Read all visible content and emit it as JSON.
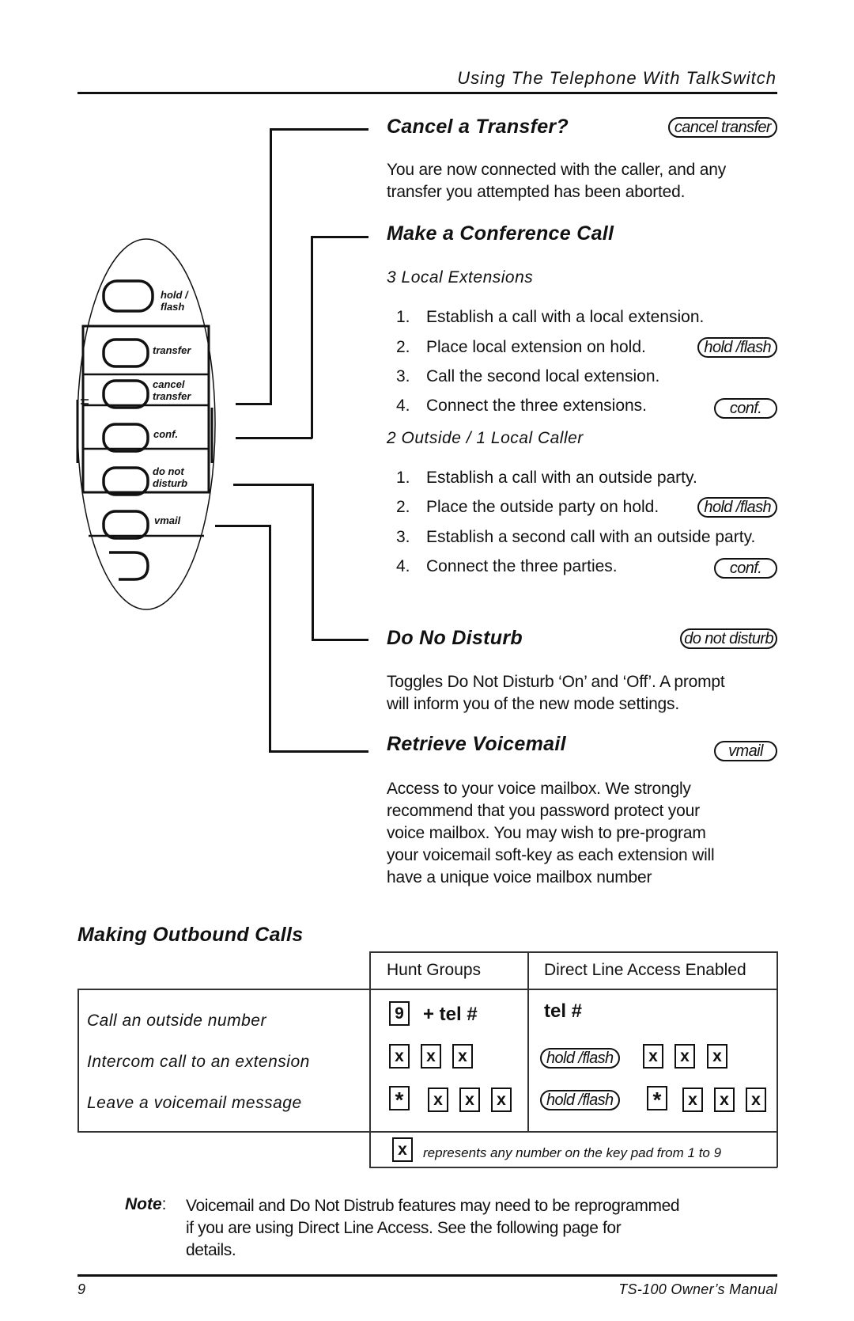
{
  "header": {
    "running_title": "Using The Telephone With TalkSwitch"
  },
  "phone_keys": [
    {
      "label_lines": [
        "hold /",
        "flash"
      ]
    },
    {
      "label_lines": [
        "transfer"
      ]
    },
    {
      "label_lines": [
        "cancel",
        "transfer"
      ]
    },
    {
      "label_lines": [
        "conf."
      ]
    },
    {
      "label_lines": [
        "do not",
        "disturb"
      ]
    },
    {
      "label_lines": [
        "vmail"
      ]
    }
  ],
  "sections": {
    "cancel_transfer": {
      "title": "Cancel a Transfer?",
      "key": "cancel transfer",
      "body": [
        "You are now connected with the caller, and any",
        "transfer you attempted has been aborted."
      ]
    },
    "conference": {
      "title": "Make a Conference Call",
      "local": {
        "subtitle": "3 Local Extensions",
        "steps": [
          {
            "num": "1.",
            "text": "Establish a call with a local extension.",
            "key": ""
          },
          {
            "num": "2.",
            "text": "Place local extension on hold.",
            "key": "hold /flash"
          },
          {
            "num": "3.",
            "text": "Call the second local extension.",
            "key": ""
          },
          {
            "num": "4.",
            "text": "Connect the three extensions.",
            "key": "conf."
          }
        ]
      },
      "outside": {
        "subtitle": "2 Outside /  1 Local Caller",
        "steps": [
          {
            "num": "1.",
            "text": "Establish a call with an outside party.",
            "key": ""
          },
          {
            "num": "2.",
            "text": "Place the outside party on hold.",
            "key": "hold /flash"
          },
          {
            "num": "3.",
            "text": "Establish a second call with an outside party.",
            "key": ""
          },
          {
            "num": "4.",
            "text": "Connect the three parties.",
            "key": "conf."
          }
        ]
      }
    },
    "dnd": {
      "title": "Do No Disturb",
      "key": "do not disturb",
      "body": [
        "Toggles Do Not Disturb ‘On’ and ‘Off’.  A prompt",
        "will inform you of the new mode settings."
      ]
    },
    "voicemail": {
      "title": "Retrieve Voicemail",
      "key": "vmail",
      "body": [
        "Access to your voice mailbox.  We strongly",
        "recommend that you password protect your",
        "voice mailbox.  You may wish to pre-program",
        "your voicemail soft-key as each extension will",
        "have a unique voice mailbox number"
      ]
    }
  },
  "outbound": {
    "title": "Making Outbound Calls",
    "columns": [
      "Hunt Groups",
      "Direct Line Access Enabled"
    ],
    "rows": [
      {
        "label": "Call an outside number",
        "hunt": {
          "box": "9",
          "text": "+ tel #"
        },
        "direct": {
          "text": "tel #"
        }
      },
      {
        "label": "Intercom call to an extension",
        "hunt": {
          "boxes": [
            "x",
            "x",
            "x"
          ]
        },
        "direct": {
          "key": "hold /flash",
          "boxes": [
            "x",
            "x",
            "x"
          ]
        }
      },
      {
        "label": "Leave a voicemail message",
        "hunt": {
          "boxes": [
            "*",
            "x",
            "x",
            "x"
          ]
        },
        "direct": {
          "key": "hold /flash",
          "boxes": [
            "*",
            "x",
            "x",
            "x"
          ]
        }
      }
    ],
    "legend": {
      "box": "x",
      "text": "represents any number on the key pad from 1 to 9"
    }
  },
  "note": {
    "label": "Note",
    "lines": [
      "Voicemail and Do Not Distrub features may need to be reprogrammed",
      "if you are using Direct Line Access.  See the following page for",
      "details."
    ]
  },
  "footer": {
    "page_number": "9",
    "manual_title": "TS-100  Owner’s Manual"
  }
}
